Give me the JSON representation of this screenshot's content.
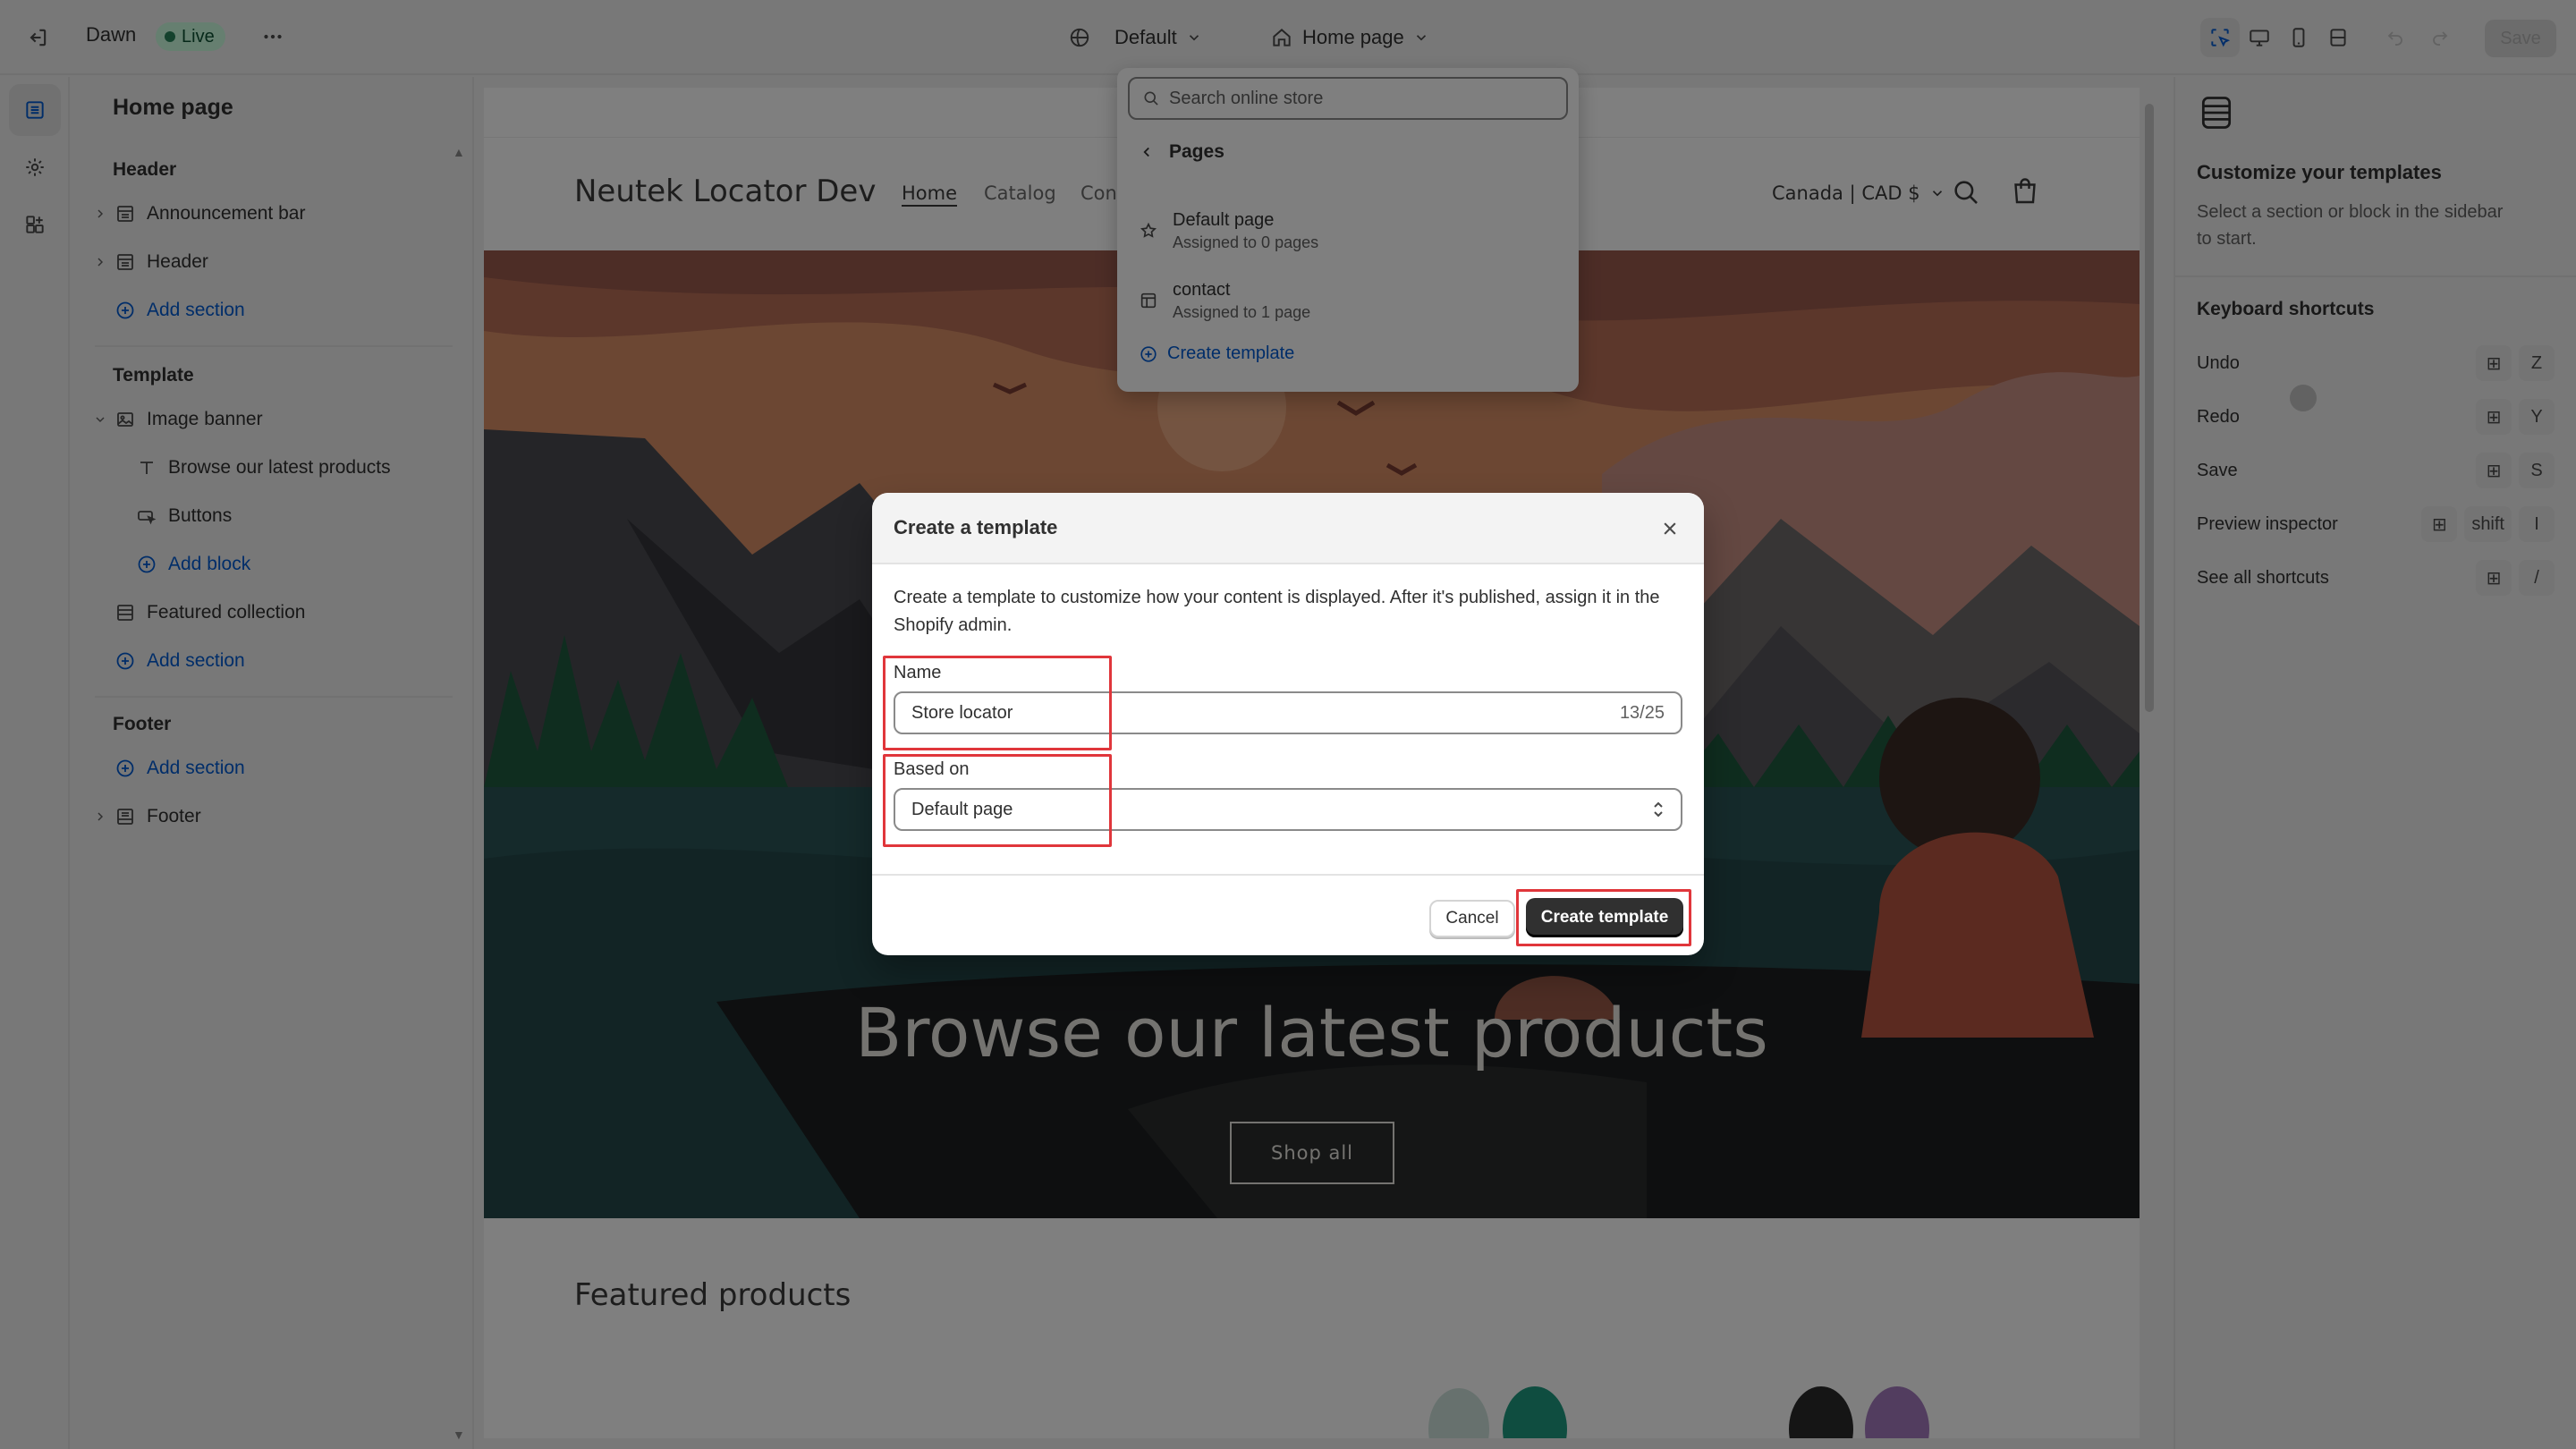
{
  "topbar": {
    "theme_name": "Dawn",
    "live_label": "Live",
    "template_select": "Default",
    "page_select": "Home page",
    "save_label": "Save"
  },
  "sidebar": {
    "title": "Home page",
    "groups": {
      "header": {
        "title": "Header",
        "items": [
          "Announcement bar",
          "Header"
        ],
        "add_label": "Add section"
      },
      "template": {
        "title": "Template",
        "section": "Image banner",
        "blocks": [
          "Browse our latest products",
          "Buttons"
        ],
        "add_block_label": "Add block",
        "collection": "Featured collection",
        "add_label": "Add section"
      },
      "footer": {
        "title": "Footer",
        "add_label": "Add section",
        "item": "Footer"
      }
    }
  },
  "preview": {
    "store_name": "Neutek Locator Dev",
    "nav": [
      "Home",
      "Catalog",
      "Cont"
    ],
    "currency": "Canada | CAD $",
    "banner_heading": "Browse our latest products",
    "shop_all": "Shop all",
    "featured_title": "Featured products"
  },
  "popover": {
    "search_placeholder": "Search online store",
    "back_label": "Pages",
    "items": [
      {
        "title": "Default page",
        "subtitle": "Assigned to 0 pages"
      },
      {
        "title": "contact",
        "subtitle": "Assigned to 1 page"
      }
    ],
    "create_label": "Create template"
  },
  "right_panel": {
    "title": "Customize your templates",
    "subtitle": "Select a section or block in the sidebar to start.",
    "shortcuts_title": "Keyboard shortcuts",
    "shortcuts": [
      {
        "label": "Undo",
        "keys": [
          "⊞",
          "Z"
        ]
      },
      {
        "label": "Redo",
        "keys": [
          "⊞",
          "Y"
        ]
      },
      {
        "label": "Save",
        "keys": [
          "⊞",
          "S"
        ]
      },
      {
        "label": "Preview inspector",
        "keys": [
          "⊞",
          "shift",
          "I"
        ]
      },
      {
        "label": "See all shortcuts",
        "keys": [
          "⊞",
          "/"
        ]
      }
    ]
  },
  "modal": {
    "title": "Create a template",
    "description": "Create a template to customize how your content is displayed. After it's published, assign it in the Shopify admin.",
    "name_label": "Name",
    "name_value": "Store locator",
    "name_count": "13/25",
    "based_on_label": "Based on",
    "based_on_value": "Default page",
    "cancel_label": "Cancel",
    "create_label": "Create template"
  },
  "colors": {
    "accent_link": "#005bd3",
    "live_badge_bg": "#cdfee1",
    "highlight_red": "#e0363b",
    "primary_button": "#303030"
  }
}
